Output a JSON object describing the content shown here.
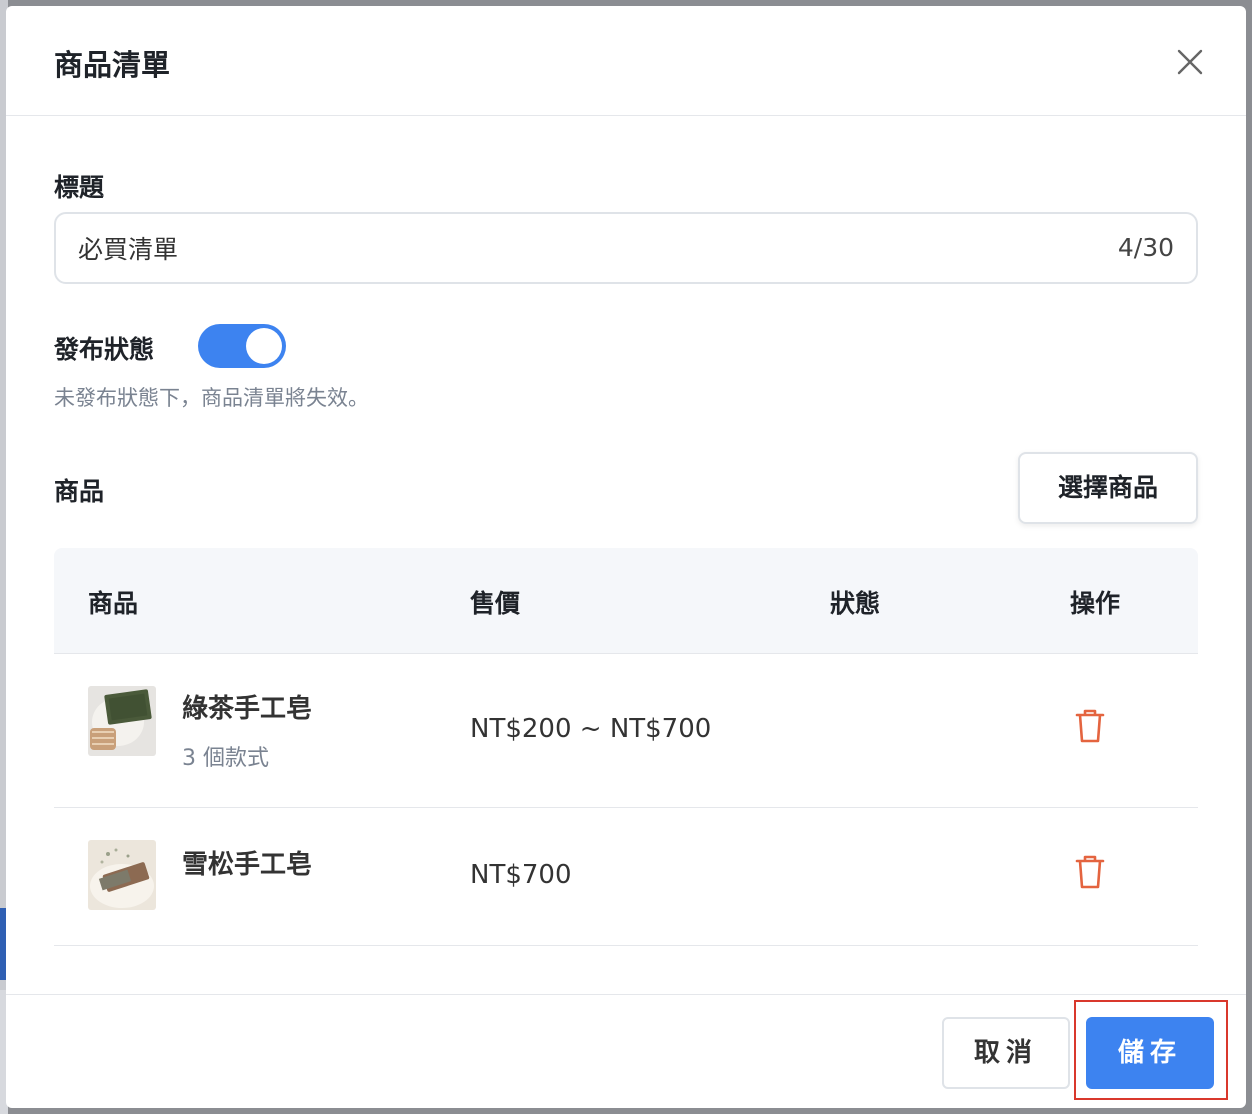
{
  "modal": {
    "title": "商品清單"
  },
  "form": {
    "title_label": "標題",
    "title_value": "必買清單",
    "title_count": "4/30",
    "publish_label": "發布狀態",
    "publish_on": true,
    "publish_hint": "未發布狀態下，商品清單將失效。",
    "products_label": "商品",
    "select_products_button": "選擇商品"
  },
  "table": {
    "headers": {
      "product": "商品",
      "price": "售價",
      "status": "狀態",
      "actions": "操作"
    },
    "rows": [
      {
        "name": "綠茶手工皂",
        "variants": "3 個款式",
        "price": "NT$200 ~ NT$700",
        "status": "",
        "action_icon": "trash-icon"
      },
      {
        "name": "雪松手工皂",
        "variants": "",
        "price": "NT$700",
        "status": "",
        "action_icon": "trash-icon"
      }
    ]
  },
  "footer": {
    "cancel_label": "取消",
    "save_label": "儲存"
  },
  "colors": {
    "accent": "#3d83f0",
    "danger": "#e4643f",
    "highlight": "#d9382c"
  }
}
